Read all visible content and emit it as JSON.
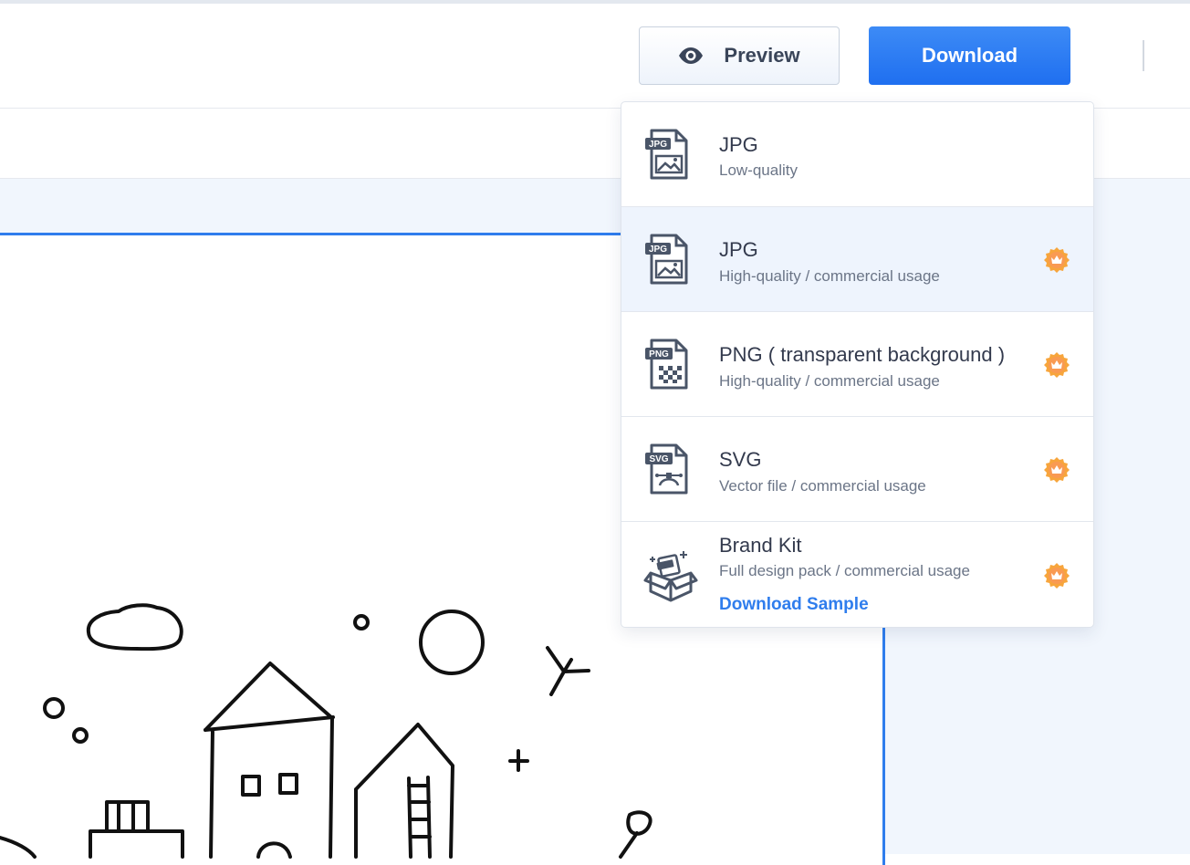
{
  "header": {
    "preview_label": "Preview",
    "download_label": "Download"
  },
  "download_menu": {
    "items": [
      {
        "icon": "jpg-file-icon",
        "title": "JPG",
        "subtitle": "Low-quality",
        "premium": false
      },
      {
        "icon": "jpg-file-icon",
        "title": "JPG",
        "subtitle": "High-quality / commercial usage",
        "premium": true
      },
      {
        "icon": "png-file-icon",
        "title": "PNG ( transparent background )",
        "subtitle": "High-quality / commercial usage",
        "premium": true
      },
      {
        "icon": "svg-file-icon",
        "title": "SVG",
        "subtitle": "Vector file / commercial usage",
        "premium": true
      },
      {
        "icon": "brand-kit-box-icon",
        "title": "Brand Kit",
        "subtitle": "Full design pack / commercial usage",
        "premium": true,
        "link": "Download Sample"
      }
    ],
    "badge_labels": {
      "jpg": "JPG",
      "png": "PNG",
      "svg": "SVG"
    }
  },
  "colors": {
    "accent": "#2f7ded",
    "premium_crown": "#f7a53c",
    "highlight_row": "#eef4fd",
    "canvas_background": "#f1f6fd"
  }
}
